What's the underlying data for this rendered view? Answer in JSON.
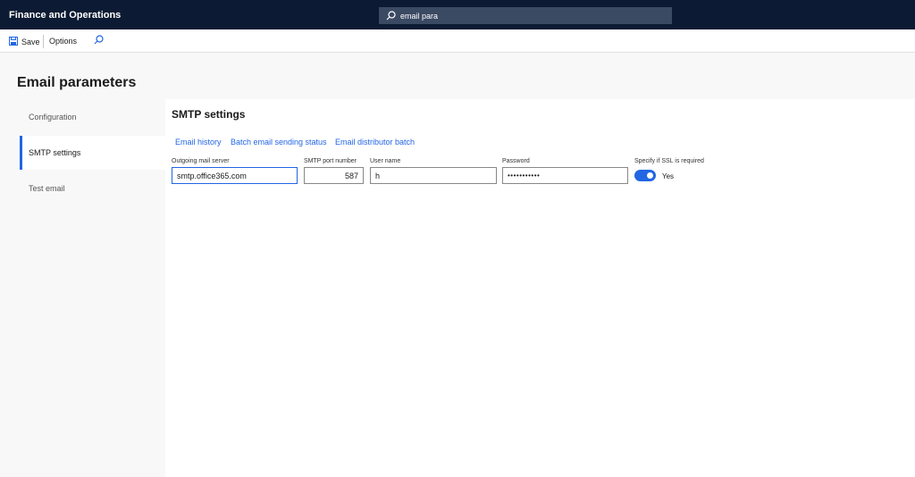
{
  "topbar": {
    "app_title": "Finance and Operations",
    "search": {
      "value": "email para",
      "icon": "search-icon"
    }
  },
  "actionbar": {
    "save_label": "Save",
    "options_label": "Options",
    "find_icon": "search-icon"
  },
  "page": {
    "title": "Email parameters"
  },
  "nav": {
    "items": [
      {
        "label": "Configuration",
        "selected": false
      },
      {
        "label": "SMTP settings",
        "selected": true
      },
      {
        "label": "Test email",
        "selected": false
      }
    ]
  },
  "smtp": {
    "section_title": "SMTP settings",
    "links": [
      "Email history",
      "Batch email sending status",
      "Email distributor batch"
    ],
    "fields": {
      "outgoing_server": {
        "label": "Outgoing mail server",
        "value": "smtp.office365.com"
      },
      "port": {
        "label": "SMTP port number",
        "value": "587"
      },
      "username": {
        "label": "User name",
        "value": "h"
      },
      "password": {
        "label": "Password",
        "value": "•••••••••••"
      },
      "ssl": {
        "label": "Specify if SSL is required",
        "value": "Yes",
        "on": true
      }
    }
  },
  "colors": {
    "topbar": "#0c1b33",
    "accent": "#2266e3",
    "link": "#2266e3"
  }
}
